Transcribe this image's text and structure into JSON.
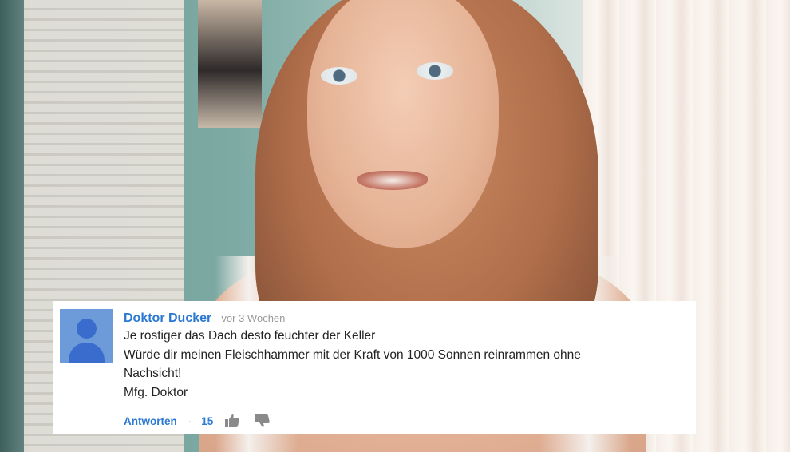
{
  "comment": {
    "author": "Doktor Ducker",
    "time": "vor 3 Wochen",
    "lines": [
      "Je rostiger das Dach desto feuchter der Keller",
      "Würde dir meinen Fleischhammer mit der Kraft von 1000 Sonnen reinrammen ohne",
      "Nachsicht!",
      "Mfg. Doktor"
    ],
    "reply_label": "Antworten",
    "separator": "·",
    "like_count": "15"
  },
  "colors": {
    "link_blue": "#2b79d2",
    "avatar_bg": "#6d9bd9",
    "avatar_fg": "#3a6ccd",
    "time_gray": "#9a9a9a",
    "thumb_gray": "#8a8a8a"
  },
  "icons": {
    "avatar": "default-user-avatar-icon",
    "like": "thumbs-up-icon",
    "dislike": "thumbs-down-icon"
  }
}
